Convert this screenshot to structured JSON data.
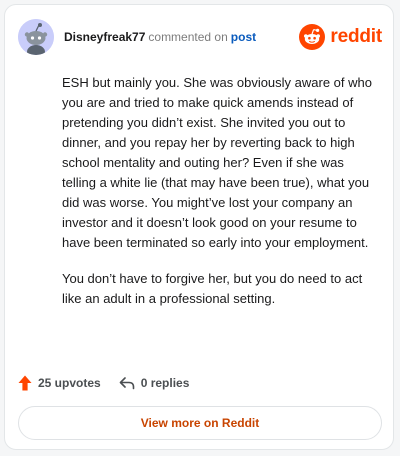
{
  "header": {
    "username": "Disneyfreak77",
    "action_text": "commented on",
    "link_text": "post",
    "brand_name": "reddit",
    "brand_color": "#ff4500"
  },
  "avatar": {
    "icon": "reddit-snoo-avatar-icon",
    "background": "#c9cdfa"
  },
  "comment": {
    "paragraphs": [
      "ESH but mainly you. She was obviously aware of who you are and tried to make quick amends instead of pretending you didn’t exist. She invited you out to dinner, and you repay her by reverting back to high school mentality and outing her? Even if she was telling a white lie (that may have been true), what you did was worse. You might’ve lost your company an investor and it doesn’t look good on your resume to have been terminated so early into your employment.",
      "You don’t have to forgive her, but you do need to act like an adult in a professional setting."
    ]
  },
  "actions": {
    "upvotes_label": "25 upvotes",
    "replies_label": "0 replies",
    "upvote_icon": "upvote-arrow-icon",
    "reply_icon": "reply-arrow-icon"
  },
  "footer": {
    "view_more_label": "View more on Reddit"
  }
}
